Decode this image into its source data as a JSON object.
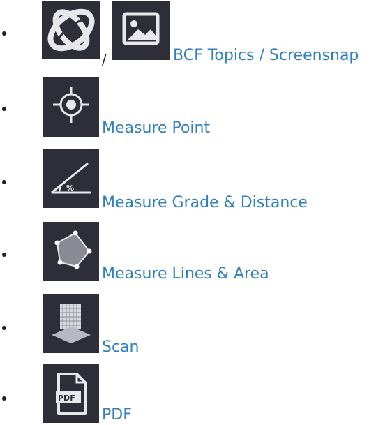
{
  "items": [
    {
      "icons": [
        "orbit-icon",
        "image-icon"
      ],
      "separator": "/",
      "label": "BCF Topics / Screensnap"
    },
    {
      "icons": [
        "crosshair-icon"
      ],
      "label": "Measure Point"
    },
    {
      "icons": [
        "grade-angle-icon"
      ],
      "label": "Measure Grade & Distance"
    },
    {
      "icons": [
        "polygon-area-icon"
      ],
      "label": "Measure Lines & Area"
    },
    {
      "icons": [
        "scan-icon"
      ],
      "label": "Scan"
    },
    {
      "icons": [
        "pdf-icon"
      ],
      "label": "PDF",
      "icon_text": "PDF"
    }
  ],
  "colors": {
    "link": "#2f7fc1",
    "tile": "#2e2e38",
    "icon": "#e8e8ec"
  }
}
